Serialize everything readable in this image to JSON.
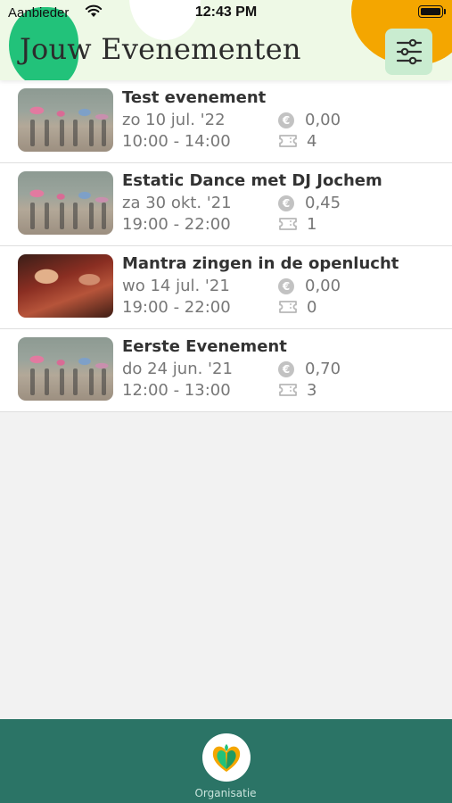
{
  "status_bar": {
    "carrier": "Aanbieder",
    "time": "12:43 PM"
  },
  "header": {
    "title": "Jouw Evenementen",
    "filter_icon": "sliders-icon"
  },
  "events": [
    {
      "title": "Test evenement",
      "date": "zo 10 jul. '22",
      "time": "10:00 - 14:00",
      "price": "0,00",
      "tickets": "4",
      "image": "dance"
    },
    {
      "title": "Estatic Dance met DJ Jochem",
      "date": "za 30 okt. '21",
      "time": "19:00 - 22:00",
      "price": "0,45",
      "tickets": "1",
      "image": "dance"
    },
    {
      "title": "Mantra zingen in de openlucht",
      "date": "wo 14 jul. '21",
      "time": "19:00 - 22:00",
      "price": "0,00",
      "tickets": "0",
      "image": "mantra"
    },
    {
      "title": "Eerste Evenement",
      "date": "do 24 jun. '21",
      "time": "12:00 - 13:00",
      "price": "0,70",
      "tickets": "3",
      "image": "dance"
    }
  ],
  "icons": {
    "price": "euro-coin-icon",
    "tickets": "ticket-icon"
  },
  "tab_bar": {
    "items": [
      {
        "label": "Organisatie",
        "icon": "heart-leaf-logo-icon"
      }
    ]
  },
  "colors": {
    "header_bg": "#eef9e6",
    "tab_bar_bg": "#2b7466",
    "accent_green": "#22c27a",
    "accent_orange": "#f4a600"
  }
}
